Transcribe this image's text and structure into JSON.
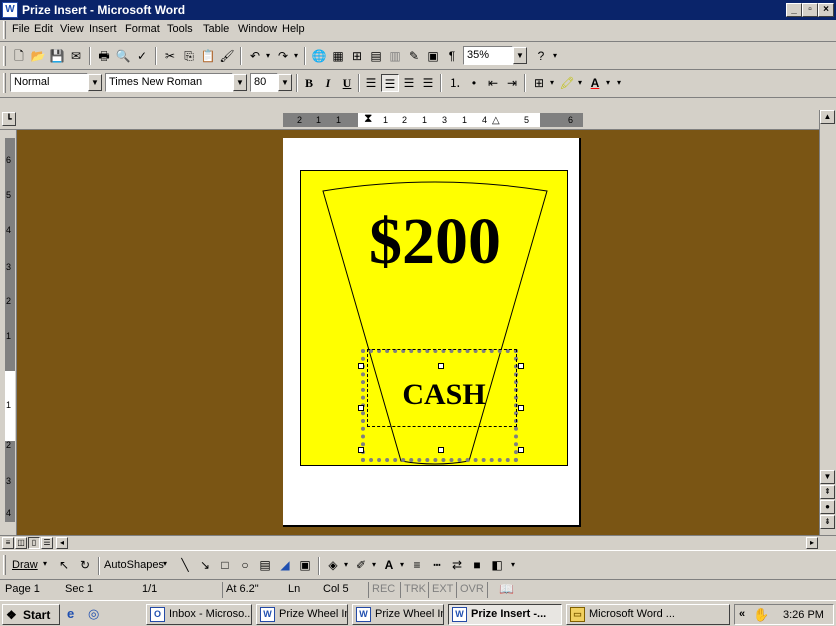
{
  "window": {
    "title": "Prize Insert - Microsoft Word"
  },
  "menu": [
    "File",
    "Edit",
    "View",
    "Insert",
    "Format",
    "Tools",
    "Table",
    "Window",
    "Help"
  ],
  "standard_toolbar": {
    "zoom": "35%"
  },
  "formatting_toolbar": {
    "style": "Normal",
    "font": "Times New Roman",
    "size": "80"
  },
  "ruler": {
    "h_numbers": [
      "2",
      "1",
      "1",
      "1",
      "2",
      "1",
      "3",
      "1",
      "4",
      "1",
      "5",
      "1",
      "6"
    ],
    "v_numbers": [
      "6",
      "5",
      "4",
      "3",
      "2",
      "1",
      "1",
      "2",
      "3",
      "4"
    ]
  },
  "document": {
    "amount": "$200",
    "label": "CASH"
  },
  "drawing_toolbar": {
    "draw_label": "Draw",
    "autoshapes_label": "AutoShapes"
  },
  "status": {
    "page": "Page 1",
    "sec": "Sec 1",
    "pages": "1/1",
    "at": "At 6.2\"",
    "ln": "Ln",
    "col": "Col 5",
    "rec": "REC",
    "trk": "TRK",
    "ext": "EXT",
    "ovr": "OVR"
  },
  "taskbar": {
    "start": "Start",
    "tasks": [
      "Inbox - Microso...",
      "Prize Wheel Ins...",
      "Prize Wheel Ins...",
      "Prize Insert -...",
      "Microsoft Word ..."
    ],
    "clock": "3:26 PM",
    "tray_arrows": "«"
  },
  "colors": {
    "titlebar": "#0a246a",
    "workspace": "#7a5514",
    "card": "#ffff00"
  },
  "icons": [
    "word-icon",
    "new-icon",
    "open-icon",
    "save-icon",
    "print-icon",
    "undo-icon",
    "redo-icon",
    "bold-icon",
    "italic-icon",
    "underline-icon",
    "ie-icon",
    "outlook-icon",
    "clock-icon"
  ]
}
